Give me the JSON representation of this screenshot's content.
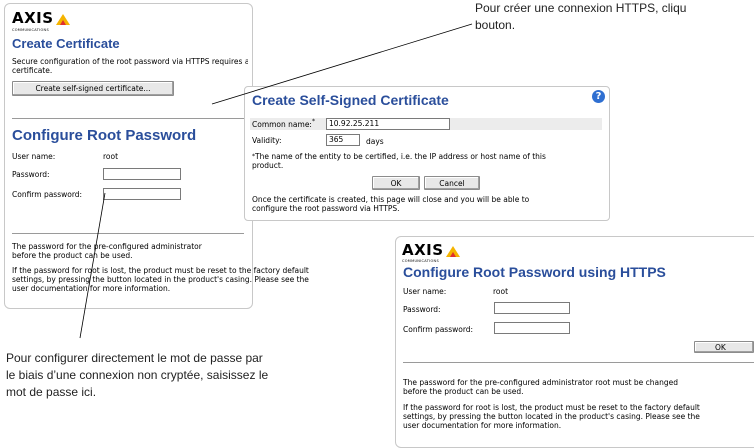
{
  "top_callout": {
    "text_line1": "Pour créer une connexion HTTPS, cliqu",
    "text_line2": "bouton."
  },
  "bottom_callout": {
    "line1": "Pour configurer directement le mot de passe par",
    "line2": "le biais d’une connexion non cryptée, saisissez le",
    "line3": "mot de passe ici."
  },
  "logo": {
    "text": "AXIS",
    "sub": "COMMUNICATIONS"
  },
  "main_panel": {
    "create_cert_title": "Create Certificate",
    "create_cert_desc_a": "Secure configuration of the root password via HTTPS requires a self-signed",
    "create_cert_desc_b": "certificate.",
    "create_cert_button": "Create self-signed certificate...",
    "root_title": "Configure Root Password",
    "user_label": "User name:",
    "user_value": "root",
    "password_label": "Password:",
    "confirm_label": "Confirm password:",
    "note1_a": "The password for the pre-configured administrator",
    "note1_b": "before the product can be used.",
    "note2_a": "If the password for root is lost, the product must be reset to the factory default",
    "note2_b": "settings, by pressing the button located in the product's casing. Please see the",
    "note2_c": "user documentation for more information."
  },
  "cert_dialog": {
    "title": "Create Self-Signed Certificate",
    "help_icon_char": "?",
    "common_name_label": "Common name:",
    "common_name_value": "10.92.25.211",
    "validity_label": "Validity:",
    "validity_value": "365",
    "validity_unit": "days",
    "footnote_a": "The name of the entity to be certified, i.e. the IP address or host name of this",
    "footnote_b": "product.",
    "ok_label": "OK",
    "cancel_label": "Cancel",
    "after_a": "Once the certificate is created, this page will close and you will be able to",
    "after_b": "configure the root password via HTTPS."
  },
  "https_panel": {
    "title": "Configure Root Password using HTTPS",
    "user_label": "User name:",
    "user_value": "root",
    "password_label": "Password:",
    "confirm_label": "Confirm password:",
    "ok_label": "OK",
    "note1_a": "The password for the pre-configured administrator root must be changed",
    "note1_b": "before the product can be used.",
    "note2_a": "If the password for root is lost, the product must be reset to the factory default",
    "note2_b": "settings, by pressing the button located in the product's casing. Please see the",
    "note2_c": "user documentation for more information."
  },
  "colors": {
    "title_blue": "#2a4e9b",
    "logo_yellow": "#f5b400",
    "logo_red": "#e03030",
    "help_blue": "#2f6fd1"
  }
}
